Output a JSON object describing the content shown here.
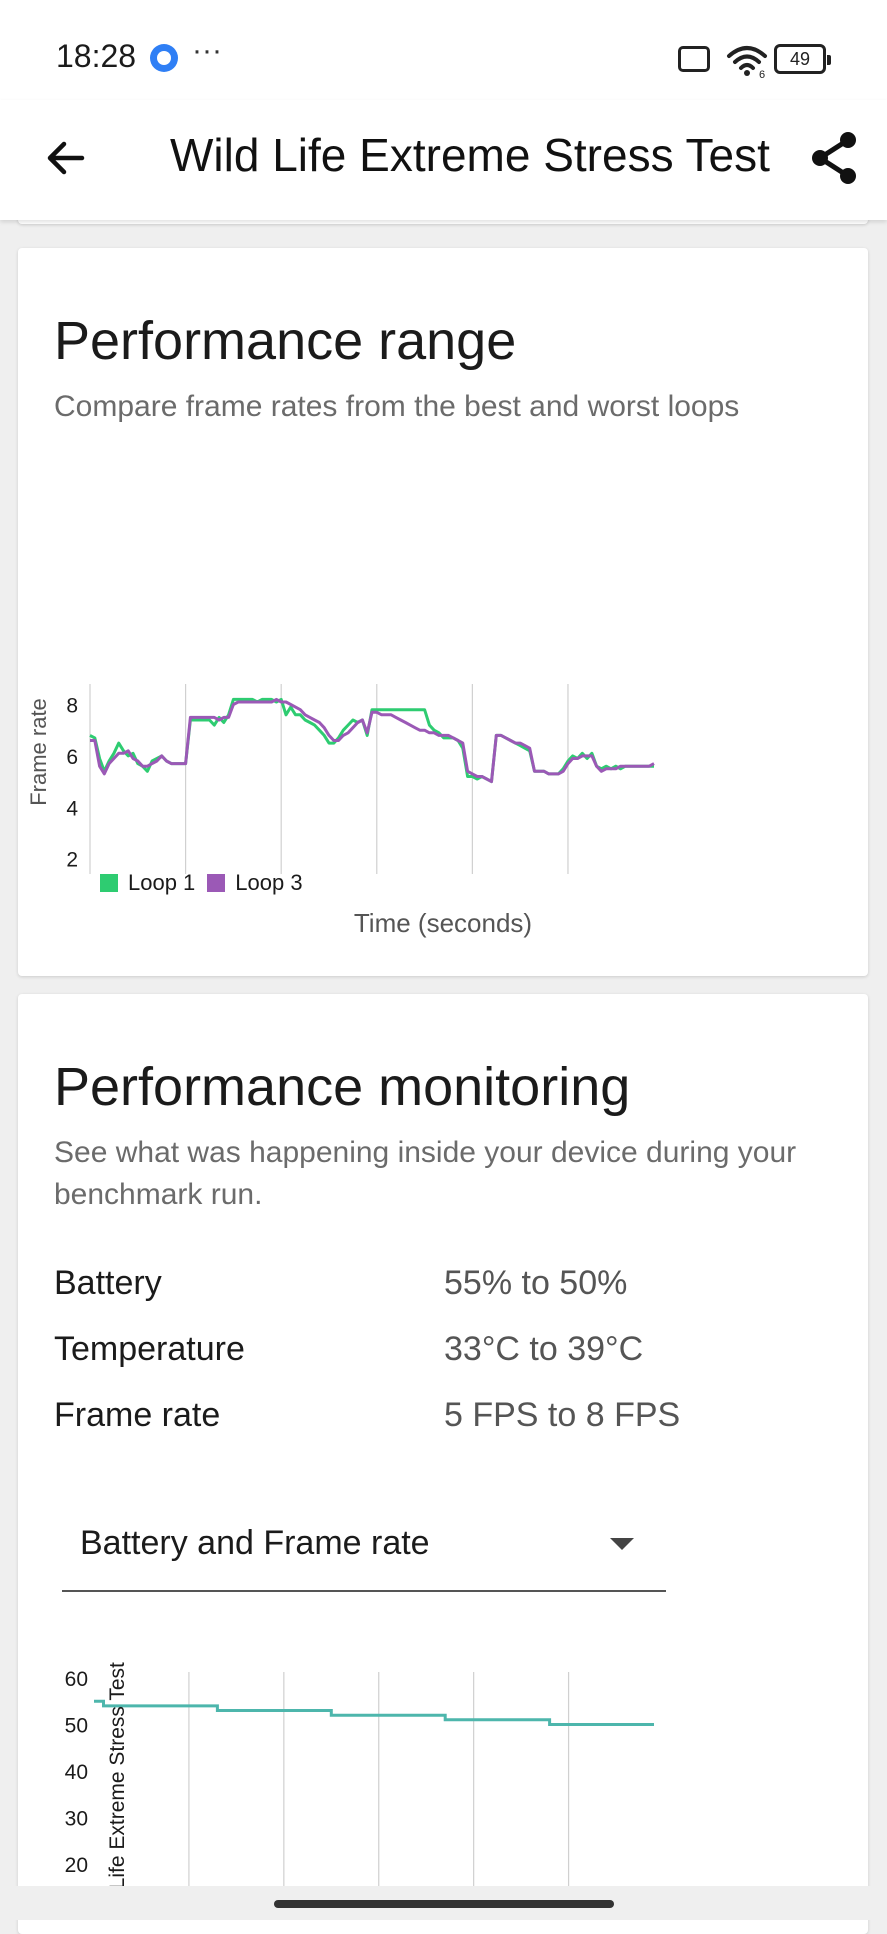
{
  "status_bar": {
    "time": "18:28",
    "more": "···",
    "battery": "49",
    "network": "6"
  },
  "app_bar": {
    "title": "Wild Life Extreme Stress Test",
    "back_icon": "arrow-left-icon",
    "share_icon": "share-icon"
  },
  "range_card": {
    "title": "Performance range",
    "subtitle": "Compare frame rates from the best and worst loops",
    "x_title": "Time (seconds)",
    "y_title": "Frame rate",
    "legend": [
      {
        "label": "Loop 1",
        "color": "#2ecc71"
      },
      {
        "label": "Loop 3",
        "color": "#9b59b6"
      }
    ]
  },
  "monitoring_card": {
    "title": "Performance monitoring",
    "subtitle": "See what was happening inside your device during your benchmark run.",
    "metrics": [
      {
        "label": "Battery",
        "value": "55% to 50%"
      },
      {
        "label": "Temperature",
        "value": "33°C to 39°C"
      },
      {
        "label": "Frame rate",
        "value": "5 FPS to 8 FPS"
      }
    ],
    "dropdown": {
      "selected": "Battery and Frame rate"
    },
    "chart_axis_title": "Wild Life Extreme Stress Test"
  },
  "chart_data": [
    {
      "type": "line",
      "title": "Performance range",
      "xlabel": "Time (seconds)",
      "ylabel": "Frame rate",
      "xlim": [
        0,
        59
      ],
      "ylim": [
        0,
        8.8
      ],
      "x_ticks": [
        0,
        10,
        20,
        30,
        40,
        50
      ],
      "y_ticks": [
        0,
        2,
        4,
        6,
        8
      ],
      "grid": "vertical",
      "legend_position": "bottom-left",
      "series": [
        {
          "name": "Loop 1",
          "color": "#2ecc71",
          "x": [
            0,
            0.5,
            1,
            1.5,
            2,
            2.5,
            3,
            3.5,
            4,
            4.5,
            5,
            5.5,
            6,
            6.5,
            7,
            7.5,
            8,
            8.5,
            9,
            9.5,
            10,
            10.5,
            11,
            11.5,
            12,
            12.5,
            13,
            13.5,
            14,
            14.5,
            15,
            15.5,
            16,
            16.5,
            17,
            17.5,
            18,
            18.5,
            19,
            19.5,
            20,
            20.5,
            21,
            21.5,
            22,
            22.5,
            23,
            23.5,
            24,
            24.5,
            25,
            25.5,
            26,
            26.5,
            27,
            27.5,
            28,
            28.5,
            29,
            29.5,
            30,
            30.5,
            31,
            31.5,
            32,
            32.5,
            33,
            33.5,
            34,
            34.5,
            35,
            35.5,
            36,
            36.5,
            37,
            37.5,
            38,
            38.5,
            39,
            39.5,
            40,
            40.5,
            41,
            41.5,
            42,
            42.5,
            43,
            43.5,
            44,
            44.5,
            45,
            45.5,
            46,
            46.5,
            47,
            47.5,
            48,
            48.5,
            49,
            49.5,
            50,
            50.5,
            51,
            51.5,
            52,
            52.5,
            53,
            53.5,
            54,
            54.5,
            55,
            55.5,
            56,
            56.5,
            57,
            57.5,
            58,
            58.5,
            59
          ],
          "values": [
            6.8,
            6.7,
            5.9,
            5.4,
            5.8,
            6.1,
            6.5,
            6.2,
            6.0,
            6.1,
            5.7,
            5.6,
            5.4,
            5.8,
            5.9,
            6.0,
            5.8,
            5.7,
            5.7,
            5.7,
            5.7,
            7.4,
            7.4,
            7.4,
            7.4,
            7.4,
            7.2,
            7.5,
            7.3,
            7.6,
            8.2,
            8.2,
            8.2,
            8.2,
            8.2,
            8.1,
            8.2,
            8.2,
            8.2,
            8.1,
            8.2,
            7.6,
            7.9,
            7.6,
            7.6,
            7.4,
            7.3,
            7.2,
            7.0,
            6.8,
            6.5,
            6.5,
            6.7,
            7.0,
            7.2,
            7.4,
            7.3,
            7.4,
            6.8,
            7.8,
            7.8,
            7.8,
            7.8,
            7.8,
            7.8,
            7.8,
            7.8,
            7.8,
            7.8,
            7.8,
            7.8,
            7.2,
            7.0,
            6.9,
            6.7,
            6.7,
            6.7,
            6.6,
            6.3,
            5.2,
            5.2,
            5.1,
            5.2,
            5.1,
            5.0,
            6.8,
            6.8,
            6.7,
            6.6,
            6.5,
            6.4,
            6.3,
            6.2,
            5.4,
            5.4,
            5.4,
            5.3,
            5.3,
            5.3,
            5.5,
            5.8,
            6.0,
            5.9,
            6.1,
            5.9,
            6.1,
            5.6,
            5.5,
            5.6,
            5.5,
            5.6,
            5.5,
            5.6,
            5.6,
            5.6,
            5.6,
            5.6,
            5.6,
            5.6
          ],
          "note": ""
        },
        {
          "name": "Loop 3",
          "color": "#9b59b6",
          "x": [
            0,
            0.5,
            1,
            1.5,
            2,
            2.5,
            3,
            3.5,
            4,
            4.5,
            5,
            5.5,
            6,
            6.5,
            7,
            7.5,
            8,
            8.5,
            9,
            9.5,
            10,
            10.5,
            11,
            11.5,
            12,
            12.5,
            13,
            13.5,
            14,
            14.5,
            15,
            15.5,
            16,
            16.5,
            17,
            17.5,
            18,
            18.5,
            19,
            19.5,
            20,
            20.5,
            21,
            21.5,
            22,
            22.5,
            23,
            23.5,
            24,
            24.5,
            25,
            25.5,
            26,
            26.5,
            27,
            27.5,
            28,
            28.5,
            29,
            29.5,
            30,
            30.5,
            31,
            31.5,
            32,
            32.5,
            33,
            33.5,
            34,
            34.5,
            35,
            35.5,
            36,
            36.5,
            37,
            37.5,
            38,
            38.5,
            39,
            39.5,
            40,
            40.5,
            41,
            41.5,
            42,
            42.5,
            43,
            43.5,
            44,
            44.5,
            45,
            45.5,
            46,
            46.5,
            47,
            47.5,
            48,
            48.5,
            49,
            49.5,
            50,
            50.5,
            51,
            51.5,
            52,
            52.5,
            53,
            53.5,
            54,
            54.5,
            55,
            55.5,
            56,
            56.5,
            57,
            57.5,
            58,
            58.5,
            59
          ],
          "values": [
            6.6,
            6.6,
            5.6,
            5.3,
            5.7,
            5.9,
            6.1,
            6.1,
            6.2,
            5.9,
            5.8,
            5.6,
            5.6,
            5.7,
            5.8,
            6.0,
            5.8,
            5.7,
            5.7,
            5.7,
            5.7,
            7.5,
            7.5,
            7.5,
            7.5,
            7.5,
            7.5,
            7.4,
            7.5,
            7.5,
            8.0,
            8.1,
            8.1,
            8.1,
            8.1,
            8.1,
            8.1,
            8.1,
            8.1,
            8.2,
            8.1,
            8.1,
            8.0,
            7.9,
            7.8,
            7.6,
            7.5,
            7.4,
            7.3,
            7.1,
            6.8,
            6.6,
            6.6,
            6.8,
            6.9,
            7.1,
            7.3,
            7.4,
            6.9,
            7.7,
            7.7,
            7.6,
            7.6,
            7.6,
            7.5,
            7.4,
            7.3,
            7.2,
            7.1,
            7.0,
            7.0,
            6.9,
            6.9,
            6.8,
            6.8,
            6.8,
            6.7,
            6.6,
            6.5,
            5.4,
            5.3,
            5.2,
            5.2,
            5.1,
            5.0,
            6.8,
            6.8,
            6.7,
            6.6,
            6.5,
            6.5,
            6.4,
            6.3,
            5.4,
            5.4,
            5.4,
            5.3,
            5.3,
            5.3,
            5.4,
            5.7,
            5.9,
            5.9,
            6.0,
            6.0,
            6.0,
            5.6,
            5.4,
            5.5,
            5.5,
            5.5,
            5.6,
            5.6,
            5.6,
            5.6,
            5.6,
            5.6,
            5.6,
            5.7
          ]
        }
      ]
    },
    {
      "type": "line",
      "title": "",
      "ylabel": "Wild Life Extreme Stress Test",
      "ylim": [
        20,
        60
      ],
      "y_ticks": [
        20,
        30,
        40,
        50,
        60
      ],
      "grid": "vertical",
      "series": [
        {
          "name": "Battery",
          "color": "#4db6ac",
          "x": [
            0,
            0.5,
            1,
            2,
            3,
            4,
            5,
            6,
            7,
            8,
            9,
            10,
            11,
            12,
            13,
            14,
            15,
            16,
            17,
            18,
            19,
            20,
            21,
            22,
            23,
            24,
            25,
            26,
            27,
            28,
            29,
            30,
            31,
            32,
            33,
            34,
            35,
            36,
            37,
            38,
            39,
            40,
            41,
            42,
            43,
            44,
            45,
            46,
            47,
            48,
            49,
            50,
            51,
            52,
            53,
            54,
            55,
            56,
            57,
            58,
            59
          ],
          "values": [
            55,
            55,
            54,
            54,
            54,
            54,
            54,
            54,
            54,
            54,
            54,
            54,
            54,
            54,
            53,
            53,
            53,
            53,
            53,
            53,
            53,
            53,
            53,
            53,
            53,
            53,
            52,
            52,
            52,
            52,
            52,
            52,
            52,
            52,
            52,
            52,
            52,
            52,
            51,
            51,
            51,
            51,
            51,
            51,
            51,
            51,
            51,
            51,
            51,
            50,
            50,
            50,
            50,
            50,
            50,
            50,
            50,
            50,
            50,
            50,
            50
          ]
        }
      ]
    }
  ]
}
